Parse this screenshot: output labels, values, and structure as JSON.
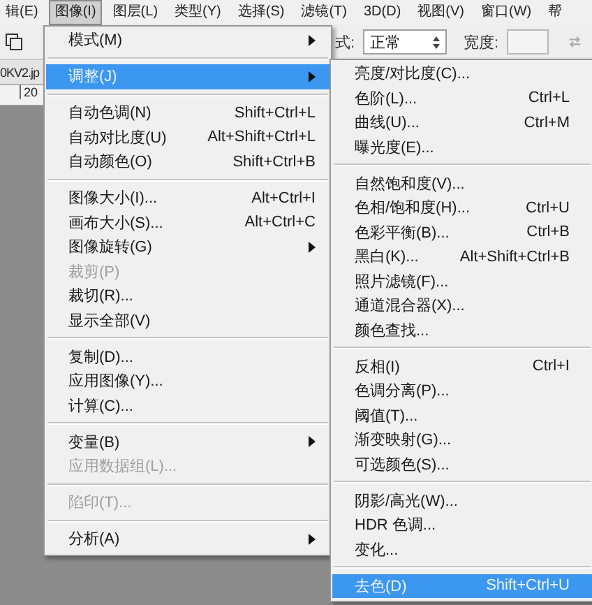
{
  "menubar": {
    "items": [
      {
        "label": "辑(E)",
        "selected": false
      },
      {
        "label": "图像(I)",
        "selected": true
      },
      {
        "label": "图层(L)",
        "selected": false
      },
      {
        "label": "类型(Y)",
        "selected": false
      },
      {
        "label": "选择(S)",
        "selected": false
      },
      {
        "label": "滤镜(T)",
        "selected": false
      },
      {
        "label": "3D(D)",
        "selected": false
      },
      {
        "label": "视图(V)",
        "selected": false
      },
      {
        "label": "窗口(W)",
        "selected": false
      },
      {
        "label": "帮",
        "selected": false
      }
    ]
  },
  "toolbar": {
    "mode_label": "式:",
    "blend_mode": "正常",
    "width_label": "宽度:"
  },
  "document_tab": {
    "title": "0KV2.jp"
  },
  "ruler": {
    "tick_label": "20"
  },
  "image_menu": {
    "groups": [
      {
        "items": [
          {
            "label": "模式(M)",
            "submenu": true,
            "disabled": false,
            "selected": false
          }
        ]
      },
      {
        "items": [
          {
            "label": "调整(J)",
            "submenu": true,
            "disabled": false,
            "selected": true
          }
        ]
      },
      {
        "items": [
          {
            "label": "自动色调(N)",
            "shortcut": "Shift+Ctrl+L",
            "submenu": false,
            "disabled": false,
            "selected": false
          },
          {
            "label": "自动对比度(U)",
            "shortcut": "Alt+Shift+Ctrl+L",
            "submenu": false,
            "disabled": false,
            "selected": false
          },
          {
            "label": "自动颜色(O)",
            "shortcut": "Shift+Ctrl+B",
            "submenu": false,
            "disabled": false,
            "selected": false
          }
        ]
      },
      {
        "items": [
          {
            "label": "图像大小(I)...",
            "shortcut": "Alt+Ctrl+I",
            "submenu": false,
            "disabled": false,
            "selected": false
          },
          {
            "label": "画布大小(S)...",
            "shortcut": "Alt+Ctrl+C",
            "submenu": false,
            "disabled": false,
            "selected": false
          },
          {
            "label": "图像旋转(G)",
            "submenu": true,
            "disabled": false,
            "selected": false
          },
          {
            "label": "裁剪(P)",
            "submenu": false,
            "disabled": true,
            "selected": false
          },
          {
            "label": "裁切(R)...",
            "submenu": false,
            "disabled": false,
            "selected": false
          },
          {
            "label": "显示全部(V)",
            "submenu": false,
            "disabled": false,
            "selected": false
          }
        ]
      },
      {
        "items": [
          {
            "label": "复制(D)...",
            "submenu": false,
            "disabled": false,
            "selected": false
          },
          {
            "label": "应用图像(Y)...",
            "submenu": false,
            "disabled": false,
            "selected": false
          },
          {
            "label": "计算(C)...",
            "submenu": false,
            "disabled": false,
            "selected": false
          }
        ]
      },
      {
        "items": [
          {
            "label": "变量(B)",
            "submenu": true,
            "disabled": false,
            "selected": false
          },
          {
            "label": "应用数据组(L)...",
            "submenu": false,
            "disabled": true,
            "selected": false
          }
        ]
      },
      {
        "items": [
          {
            "label": "陷印(T)...",
            "submenu": false,
            "disabled": true,
            "selected": false
          }
        ]
      },
      {
        "items": [
          {
            "label": "分析(A)",
            "submenu": true,
            "disabled": false,
            "selected": false
          }
        ]
      }
    ]
  },
  "adjust_submenu": {
    "groups": [
      {
        "items": [
          {
            "label": "亮度/对比度(C)...",
            "selected": false
          },
          {
            "label": "色阶(L)...",
            "shortcut": "Ctrl+L",
            "selected": false
          },
          {
            "label": "曲线(U)...",
            "shortcut": "Ctrl+M",
            "selected": false
          },
          {
            "label": "曝光度(E)...",
            "selected": false
          }
        ]
      },
      {
        "items": [
          {
            "label": "自然饱和度(V)...",
            "selected": false
          },
          {
            "label": "色相/饱和度(H)...",
            "shortcut": "Ctrl+U",
            "selected": false
          },
          {
            "label": "色彩平衡(B)...",
            "shortcut": "Ctrl+B",
            "selected": false
          },
          {
            "label": "黑白(K)...",
            "shortcut": "Alt+Shift+Ctrl+B",
            "selected": false
          },
          {
            "label": "照片滤镜(F)...",
            "selected": false
          },
          {
            "label": "通道混合器(X)...",
            "selected": false
          },
          {
            "label": "颜色查找...",
            "selected": false
          }
        ]
      },
      {
        "items": [
          {
            "label": "反相(I)",
            "shortcut": "Ctrl+I",
            "selected": false
          },
          {
            "label": "色调分离(P)...",
            "selected": false
          },
          {
            "label": "阈值(T)...",
            "selected": false
          },
          {
            "label": "渐变映射(G)...",
            "selected": false
          },
          {
            "label": "可选颜色(S)...",
            "selected": false
          }
        ]
      },
      {
        "items": [
          {
            "label": "阴影/高光(W)...",
            "selected": false
          },
          {
            "label": "HDR 色调...",
            "selected": false
          },
          {
            "label": "变化...",
            "selected": false
          }
        ]
      },
      {
        "items": [
          {
            "label": "去色(D)",
            "shortcut": "Shift+Ctrl+U",
            "selected": true
          }
        ]
      }
    ]
  }
}
